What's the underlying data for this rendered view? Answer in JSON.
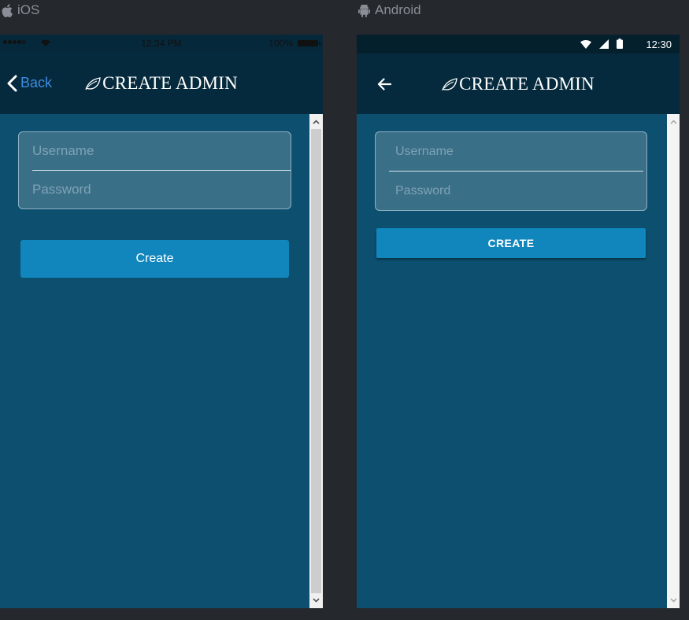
{
  "platforms": {
    "ios_label": "iOS",
    "android_label": "Android"
  },
  "ios": {
    "status": {
      "time": "12:34 PM",
      "battery": "100%"
    },
    "header": {
      "back_label": "Back",
      "title": "CREATE ADMIN"
    },
    "form": {
      "username_placeholder": "Username",
      "password_placeholder": "Password",
      "create_label": "Create"
    }
  },
  "android": {
    "status": {
      "time": "12:30"
    },
    "header": {
      "title": "CREATE ADMIN"
    },
    "form": {
      "username_placeholder": "Username",
      "password_placeholder": "Password",
      "create_label": "CREATE"
    }
  },
  "icons": {
    "apple": "apple-icon",
    "android": "android-icon",
    "back": "chevron-left-icon",
    "arrow_back": "arrow-left-icon",
    "leaf": "leaf-icon",
    "wifi": "wifi-icon",
    "signal": "signal-icon",
    "battery": "battery-icon"
  },
  "colors": {
    "page_background": "#25282d",
    "header": "#062a3d",
    "content": "#0c4f6e",
    "input_background": "#3a6f88",
    "button": "#1186bd",
    "ios_link": "#3b8ce0"
  }
}
